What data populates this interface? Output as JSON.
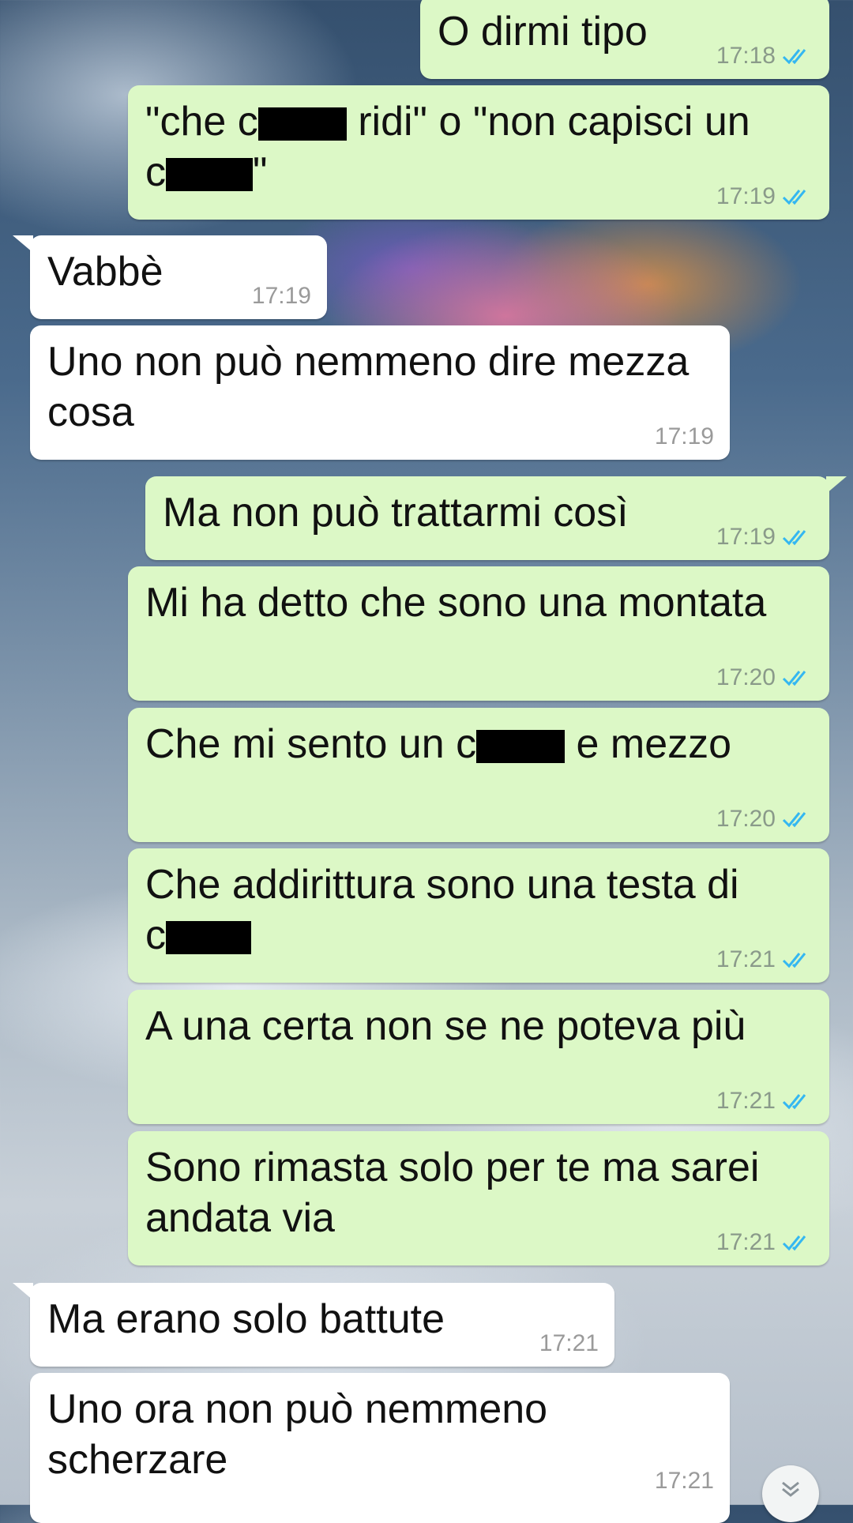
{
  "colors": {
    "outgoing_bubble": "#dcf8c6",
    "incoming_bubble": "#ffffff",
    "read_ticks": "#34b7f1"
  },
  "messages": [
    {
      "dir": "out",
      "text": "O dirmi tipo",
      "time": "17:18",
      "status": "read"
    },
    {
      "dir": "out",
      "text_parts": [
        "\"che c",
        "[redacted]",
        " ridi\" o \"non capisci un",
        "\n",
        "c",
        "[redacted]",
        "\""
      ],
      "time": "17:19",
      "status": "read"
    },
    {
      "dir": "in",
      "text": "Vabbè",
      "time": "17:19"
    },
    {
      "dir": "in",
      "text": "Uno non può nemmeno dire mezza cosa",
      "time": "17:19"
    },
    {
      "dir": "out",
      "text": "Ma non può trattarmi così",
      "time": "17:19",
      "status": "read"
    },
    {
      "dir": "out",
      "text": "Mi ha detto che sono una montata",
      "time": "17:20",
      "status": "read"
    },
    {
      "dir": "out",
      "text_parts": [
        "Che mi sento un c",
        "[redacted]",
        " e mezzo"
      ],
      "time": "17:20",
      "status": "read"
    },
    {
      "dir": "out",
      "text_parts": [
        "Che addirittura sono una testa di",
        "\n",
        "c",
        "[redacted]"
      ],
      "time": "17:21",
      "status": "read"
    },
    {
      "dir": "out",
      "text": "A una certa non se ne poteva più",
      "time": "17:21",
      "status": "read"
    },
    {
      "dir": "out",
      "text": "Sono rimasta solo per te ma sarei andata via",
      "time": "17:21",
      "status": "read"
    },
    {
      "dir": "in",
      "text": "Ma erano solo battute",
      "time": "17:21"
    },
    {
      "dir": "in",
      "text": "Uno ora non può nemmeno scherzare",
      "time": "17:21"
    }
  ],
  "scroll_button": {
    "icon": "double-chevron-down-icon"
  }
}
